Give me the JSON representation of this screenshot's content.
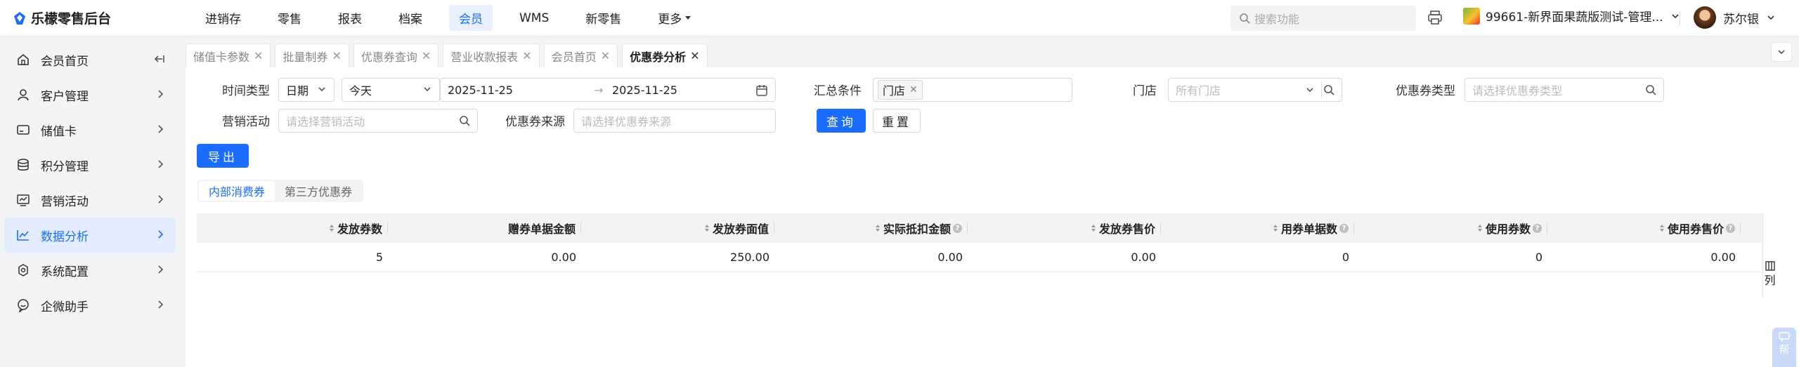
{
  "app": {
    "title": "乐檬零售后台"
  },
  "nav": {
    "items": [
      "进销存",
      "零售",
      "报表",
      "档案",
      "会员",
      "WMS",
      "新零售"
    ],
    "more": "更多",
    "active_index": 4
  },
  "header": {
    "search_placeholder": "搜索功能",
    "store": "99661-新界面果蔬版测试-管理...",
    "user": "苏尔银"
  },
  "sidebar": {
    "items": [
      {
        "label": "会员首页",
        "icon": "home-icon"
      },
      {
        "label": "客户管理",
        "icon": "user-icon"
      },
      {
        "label": "储值卡",
        "icon": "card-icon"
      },
      {
        "label": "积分管理",
        "icon": "coins-icon"
      },
      {
        "label": "营销活动",
        "icon": "chart-screen-icon"
      },
      {
        "label": "数据分析",
        "icon": "trend-icon"
      },
      {
        "label": "系统配置",
        "icon": "settings-icon"
      },
      {
        "label": "企微助手",
        "icon": "chat-icon"
      }
    ],
    "active_index": 5
  },
  "tabs": {
    "items": [
      "储值卡参数",
      "批量制券",
      "优惠券查询",
      "营业收款报表",
      "会员首页",
      "优惠券分析"
    ],
    "active_index": 5
  },
  "filters": {
    "time_type_label": "时间类型",
    "time_type_value": "日期",
    "period_value": "今天",
    "date_start": "2025-11-25",
    "date_end": "2025-11-25",
    "date_sep": "→",
    "summary_label": "汇总条件",
    "summary_chip": "门店",
    "store_label": "门店",
    "store_placeholder": "所有门店",
    "coupon_type_label": "优惠券类型",
    "coupon_type_placeholder": "请选择优惠券类型",
    "activity_label": "营销活动",
    "activity_placeholder": "请选择营销活动",
    "source_label": "优惠券来源",
    "source_placeholder": "请选择优惠券来源",
    "query_btn": "查询",
    "reset_btn": "重置",
    "export_btn": "导出"
  },
  "subtabs": {
    "items": [
      "内部消费券",
      "第三方优惠券"
    ],
    "active_index": 0
  },
  "table": {
    "columns": [
      {
        "label": "发放券数",
        "sort": true,
        "info": false
      },
      {
        "label": "赠券单据金额",
        "sort": false,
        "info": false
      },
      {
        "label": "发放券面值",
        "sort": true,
        "info": false
      },
      {
        "label": "实际抵扣金额",
        "sort": true,
        "info": true
      },
      {
        "label": "发放券售价",
        "sort": true,
        "info": false
      },
      {
        "label": "用券单据数",
        "sort": true,
        "info": true
      },
      {
        "label": "使用券数",
        "sort": true,
        "info": true
      },
      {
        "label": "使用券售价",
        "sort": true,
        "info": true
      }
    ],
    "rows": [
      [
        "5",
        "0.00",
        "250.00",
        "0.00",
        "0.00",
        "0",
        "0",
        "0.00"
      ]
    ],
    "column_setting": "列"
  },
  "help": {
    "label": "帮"
  },
  "colors": {
    "primary": "#1a6dff",
    "active_bg": "#e3ecfc"
  }
}
